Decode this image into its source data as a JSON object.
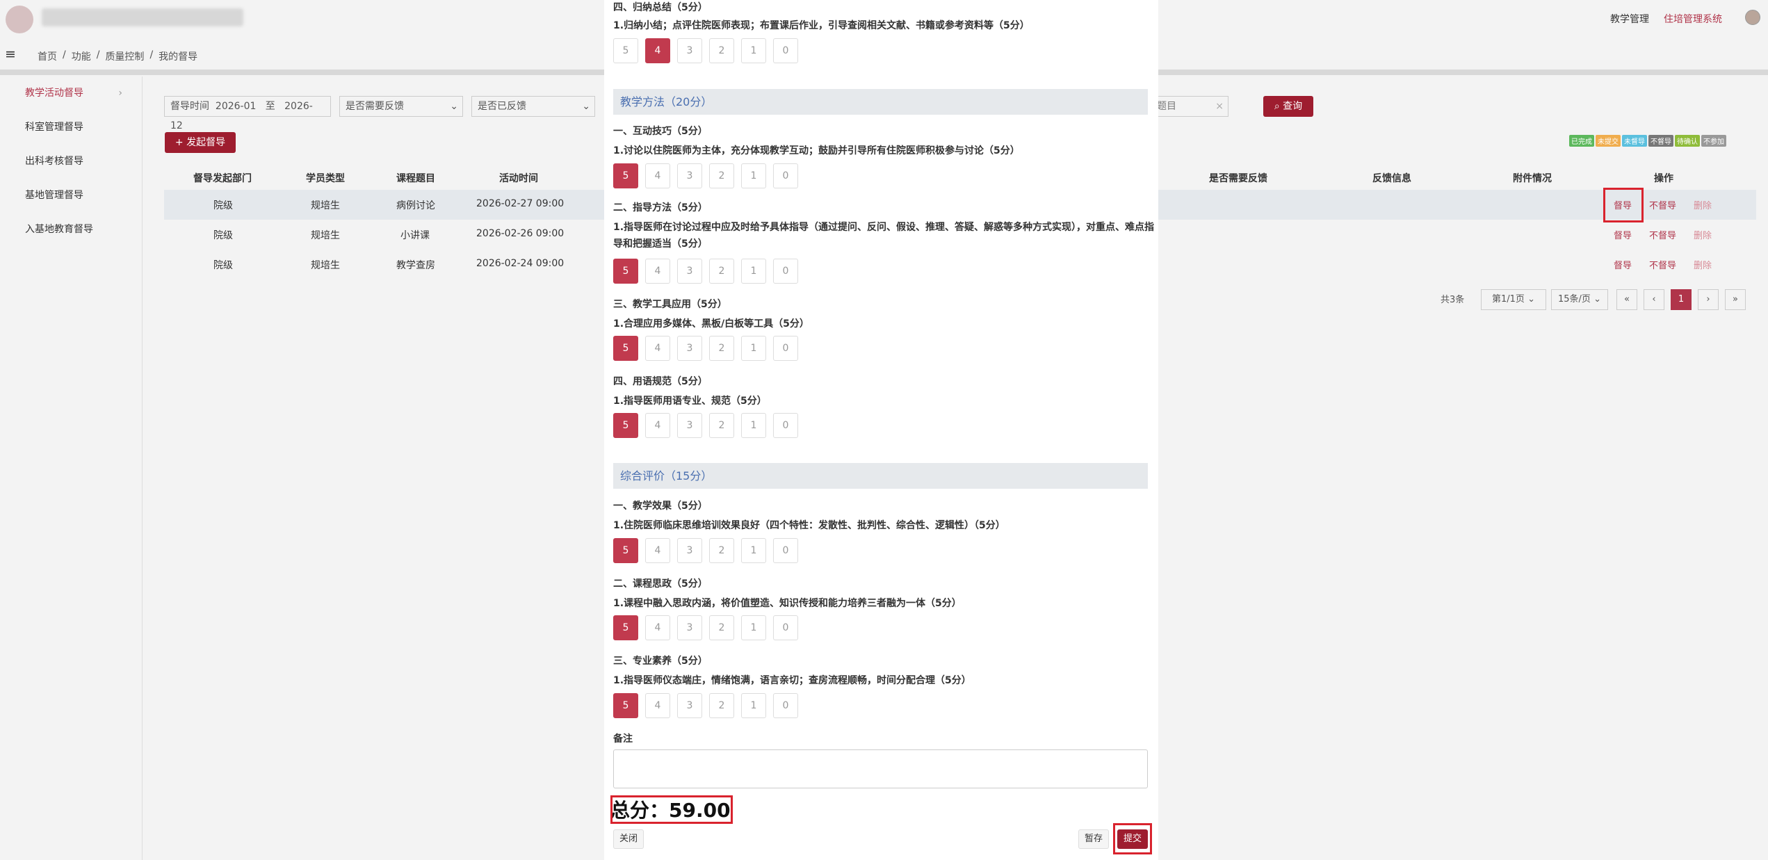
{
  "header": {
    "right_links": [
      "教学管理",
      "住培管理系统"
    ]
  },
  "breadcrumb": [
    "首页",
    "/",
    "功能",
    "/",
    "质量控制",
    "/",
    "我的督导"
  ],
  "sidebar": {
    "items": [
      "教学活动督导",
      "科室管理督导",
      "出科考核督导",
      "基地管理督导",
      "入基地教育督导"
    ],
    "chevron": "›"
  },
  "filters": {
    "time_label": "督导时间",
    "time_start": "2026-01",
    "to": "至",
    "time_end": "2026-12",
    "need_feedback": "是否需要反馈",
    "has_feedback": "是否已反馈",
    "topic_placeholder": "题目",
    "clear": "×",
    "search_btn": "查询",
    "add_btn": "发起督导"
  },
  "legend": [
    {
      "text": "已完成",
      "color": "#5cb85c"
    },
    {
      "text": "未提交",
      "color": "#f0ad4e"
    },
    {
      "text": "未督导",
      "color": "#5bc0de"
    },
    {
      "text": "不督导",
      "color": "#777777"
    },
    {
      "text": "待确认",
      "color": "#8fbc3a"
    },
    {
      "text": "不参加",
      "color": "#999999"
    }
  ],
  "table": {
    "headers": [
      "督导发起部门",
      "学员类型",
      "课程题目",
      "活动时间",
      "是否需要反馈",
      "反馈信息",
      "附件情况",
      "操作"
    ],
    "rows": [
      {
        "dept": "院级",
        "type": "规培生",
        "topic": "病例讨论",
        "time": "2026-02-27 09:00"
      },
      {
        "dept": "院级",
        "type": "规培生",
        "topic": "小讲课",
        "time": "2026-02-26 09:00"
      },
      {
        "dept": "院级",
        "type": "规培生",
        "topic": "教学查房",
        "time": "2026-02-24 09:00"
      }
    ],
    "actions": [
      "督导",
      "不督导",
      "删除"
    ]
  },
  "pagination": {
    "total": "共3条",
    "page": "第1/1页",
    "per_page": "15条/页",
    "first": "«",
    "prev": "‹",
    "current": "1",
    "next": "›",
    "last": "»"
  },
  "modal": {
    "top_category": "四、归纳总结（5分）",
    "top_question": "1.归纳小结；点评住院医师表现；布置课后作业，引导查阅相关文献、书籍或参考资料等（5分）",
    "score_options": [
      "5",
      "4",
      "3",
      "2",
      "1",
      "0"
    ],
    "sections": [
      {
        "title": "教学方法（20分）",
        "items": [
          {
            "category": "一、互动技巧（5分）",
            "question": "1.讨论以住院医师为主体，充分体现教学互动；鼓励并引导所有住院医师积极参与讨论（5分）",
            "selected": "5"
          },
          {
            "category": "二、指导方法（5分）",
            "question": "1.指导医师在讨论过程中应及时给予具体指导（通过提问、反问、假设、推理、答疑、解惑等多种方式实现），对重点、难点指导和把握适当（5分）",
            "selected": "5"
          },
          {
            "category": "三、教学工具应用（5分）",
            "question": "1.合理应用多媒体、黑板/白板等工具（5分）",
            "selected": "5"
          },
          {
            "category": "四、用语规范（5分）",
            "question": "1.指导医师用语专业、规范（5分）",
            "selected": "5"
          }
        ]
      },
      {
        "title": "综合评价（15分）",
        "items": [
          {
            "category": "一、教学效果（5分）",
            "question": "1.住院医师临床思维培训效果良好（四个特性：发散性、批判性、综合性、逻辑性）（5分）",
            "selected": "5"
          },
          {
            "category": "二、课程思政（5分）",
            "question": "1.课程中融入思政内涵，将价值塑造、知识传授和能力培养三者融为一体（5分）",
            "selected": "5"
          },
          {
            "category": "三、专业素养（5分）",
            "question": "1.指导医师仪态端庄，情绪饱满，语言亲切；查房流程顺畅，时间分配合理（5分）",
            "selected": "5"
          }
        ]
      }
    ],
    "top_selected": "4",
    "remark_label": "备注",
    "total_label": "总分：",
    "total_value": "59.00",
    "close_btn": "关闭",
    "save_btn": "暂存",
    "submit_btn": "提交"
  }
}
